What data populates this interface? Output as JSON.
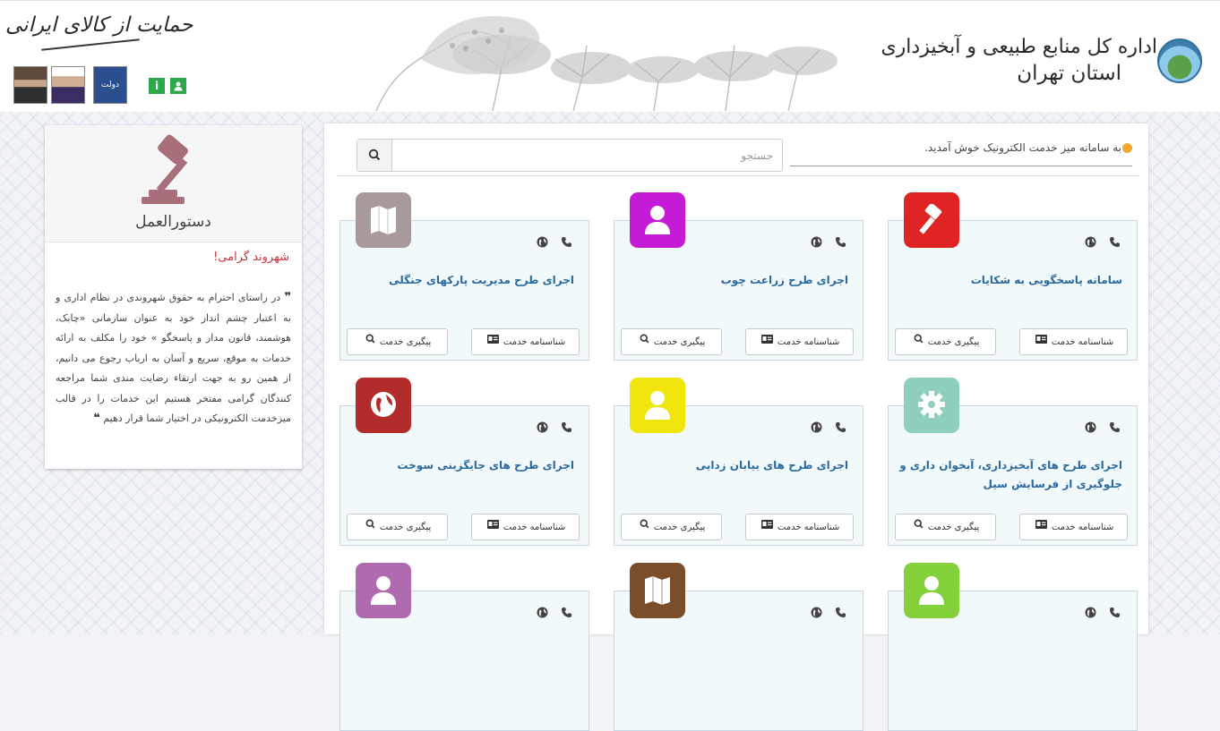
{
  "header": {
    "org_line1": "اداره کل منابع طبیعی و آبخیزداری",
    "org_line2": "استان تهران",
    "support_slogan": "حمایت از کالای ایرانی",
    "badge_text": "دولت",
    "info_glyph": "i"
  },
  "sidebar": {
    "title": "دستورالعمل",
    "greeting": "شهروند گرامی!",
    "open_quote": "❞",
    "close_quote": "❝",
    "body": "در راستای احترام به حقوق شهروندی در نظام اداری و به اعتبار چشم انداز خود به عنوان سازمانی «چابک، هوشمند، قانون مدار و پاسخگو » خود را مکلف به ارائه خدمات به موقع، سریع و آسان به ارباب رجوع می دانیم، از همین رو به جهت ارتقاء رضایت مندی شما مراجعه کنندگان گرامی مفتخر هستیم این خدمات را در قالب میزخدمت الکترونیکی در اختیار شما قرار دهیم"
  },
  "toolbar": {
    "welcome": "به سامانه میز خدمت الکترونیک خوش آمدید.",
    "search_placeholder": "جستجو",
    "search_value": ""
  },
  "labels": {
    "info": "شناسنامه خدمت",
    "track": "پیگیری خدمت"
  },
  "colors": {
    "accent_dot": "#f0a830",
    "link": "#2a6aa0",
    "greeting": "#c8353d"
  },
  "cards": [
    {
      "title": "سامانه پاسخگویی به شکایات",
      "icon": "gavel-icon",
      "color": "#e02424"
    },
    {
      "title": "اجرای طرح زراعت چوب",
      "icon": "user-icon",
      "color": "#c41cd6"
    },
    {
      "title": "اجرای طرح مدیریت پارکهای جنگلی",
      "icon": "map-icon",
      "color": "#a89a9a"
    },
    {
      "title": "اجرای طرح های آبخیزداری، آبخوان داری و جلوگیری از فرسایش سیل",
      "icon": "gear-icon",
      "color": "#8fcfbf"
    },
    {
      "title": "اجرای طرح های بیابان زدایی",
      "icon": "user-icon",
      "color": "#f1e50e"
    },
    {
      "title": "اجرای طرح های جایگزینی سوخت",
      "icon": "globe-icon",
      "color": "#b22c2c"
    },
    {
      "title": "",
      "icon": "user-icon",
      "color": "#85d13b"
    },
    {
      "title": "",
      "icon": "map-icon",
      "color": "#7a4e2a"
    },
    {
      "title": "",
      "icon": "user-icon",
      "color": "#b06ab0"
    }
  ]
}
